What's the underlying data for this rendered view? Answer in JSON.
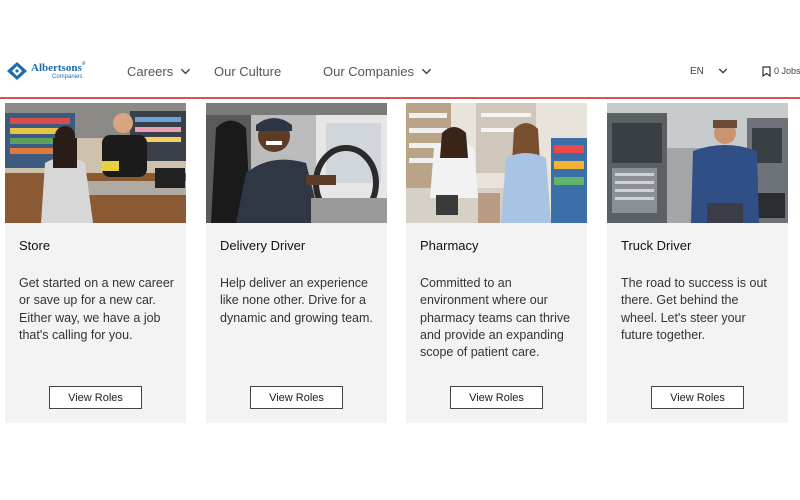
{
  "brand": {
    "name": "Albertsons",
    "registered": "®",
    "sub": "Companies",
    "color": "#1e6bb0"
  },
  "nav": {
    "careers": "Careers",
    "culture": "Our Culture",
    "companies": "Our Companies",
    "language": "EN",
    "jobs": "0 Jobs"
  },
  "accent": "#d9534f",
  "cards": [
    {
      "title": "Store",
      "text": "Get started on a new career or save up for a new car. Either way, we have a job that's calling for you.",
      "button": "View Roles"
    },
    {
      "title": "Delivery Driver",
      "text": "Help deliver an experience like none other. Drive for a dynamic and growing team.",
      "button": "View Roles"
    },
    {
      "title": "Pharmacy",
      "text": "Committed to an environment where our pharmacy teams can thrive and provide an expanding scope of patient care.",
      "button": "View Roles"
    },
    {
      "title": "Truck Driver",
      "text": "The road to success is out there. Get behind the wheel. Let's steer your future together.",
      "button": "View Roles"
    }
  ]
}
